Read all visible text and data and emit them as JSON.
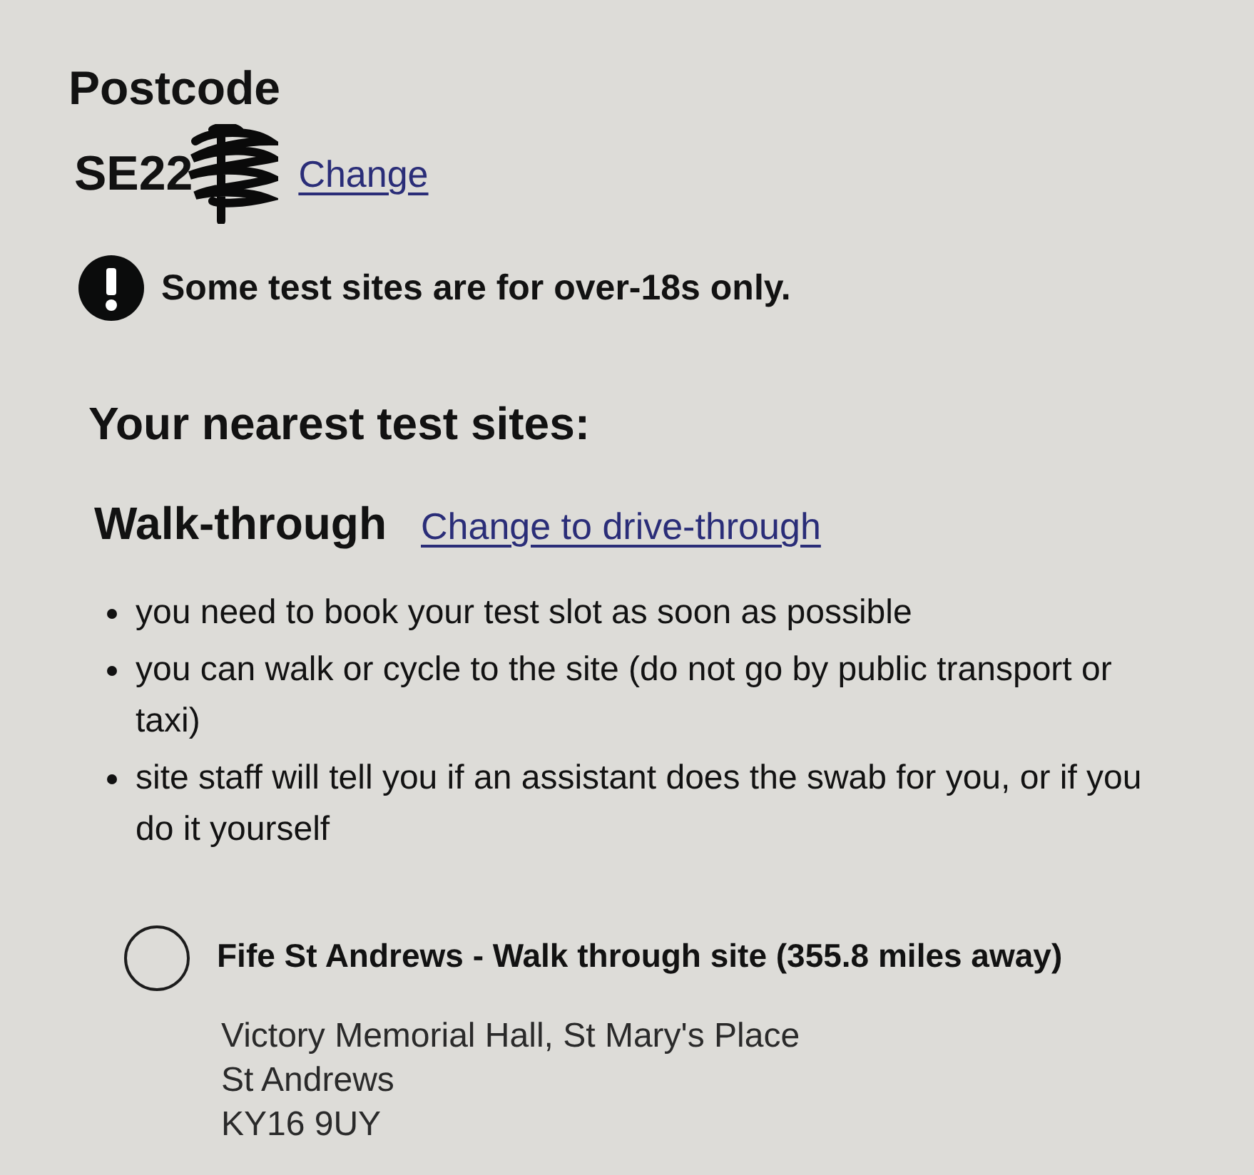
{
  "postcode": {
    "heading": "Postcode",
    "value": "SE22",
    "redacted": true,
    "change_link": "Change"
  },
  "warning": {
    "text": "Some test sites are for over-18s only."
  },
  "results": {
    "heading": "Your nearest test sites:",
    "mode": "Walk-through",
    "change_link": "Change to drive-through",
    "notes": [
      "you need to book your test slot as soon as possible",
      "you can walk or cycle to the site (do not go by public transport or taxi)",
      "site staff will tell you if an assistant does the swab for you, or if you do it yourself"
    ]
  },
  "sites": [
    {
      "name": "Fife St Andrews - Walk through site (355.8 miles away)",
      "selected": false,
      "address": [
        "Victory Memorial Hall, St Mary's Place",
        "St Andrews",
        "KY16 9UY"
      ]
    }
  ]
}
